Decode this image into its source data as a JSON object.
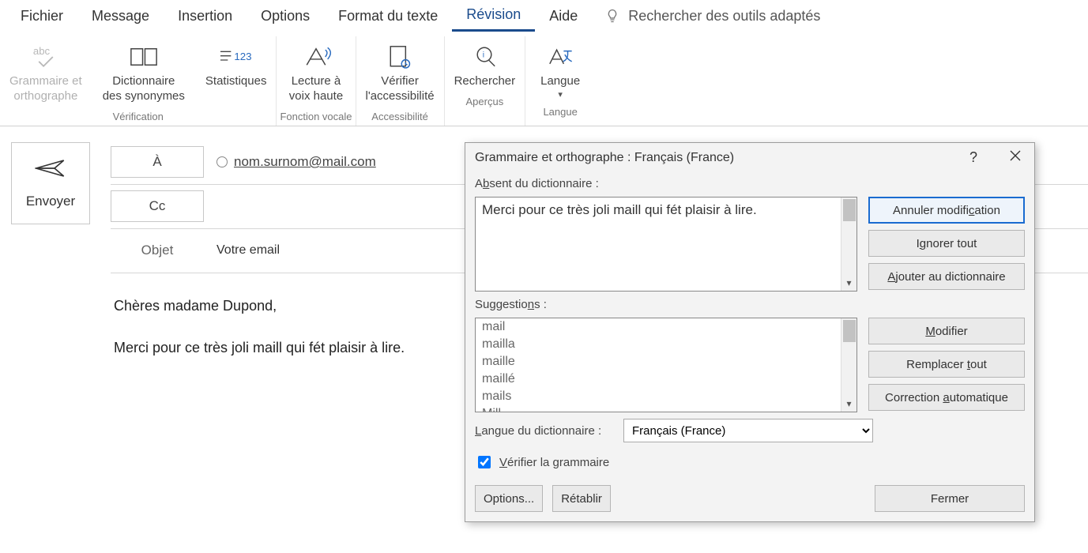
{
  "menu": {
    "items": [
      "Fichier",
      "Message",
      "Insertion",
      "Options",
      "Format du texte",
      "Révision",
      "Aide"
    ],
    "active_index": 5,
    "tellme": "Rechercher des outils adaptés"
  },
  "ribbon": {
    "groups": [
      {
        "name": "Vérification",
        "buttons": [
          {
            "label": "Grammaire et\northographe",
            "icon": "abc-check",
            "disabled": true
          },
          {
            "label": "Dictionnaire\ndes synonymes",
            "icon": "book",
            "disabled": false
          },
          {
            "label": "Statistiques",
            "icon": "count123",
            "disabled": false
          }
        ]
      },
      {
        "name": "Fonction vocale",
        "buttons": [
          {
            "label": "Lecture à\nvoix haute",
            "icon": "read-aloud",
            "disabled": false
          }
        ]
      },
      {
        "name": "Accessibilité",
        "buttons": [
          {
            "label": "Vérifier\nl'accessibilité",
            "icon": "accessibility",
            "disabled": false
          }
        ]
      },
      {
        "name": "Aperçus",
        "buttons": [
          {
            "label": "Rechercher",
            "icon": "insight",
            "disabled": false
          }
        ]
      },
      {
        "name": "Langue",
        "buttons": [
          {
            "label": "Langue",
            "icon": "language",
            "disabled": false,
            "dropdown": true
          }
        ]
      }
    ]
  },
  "compose": {
    "send": "Envoyer",
    "to_label": "À",
    "cc_label": "Cc",
    "subject_label": "Objet",
    "subject_value": "Votre email",
    "recipients": [
      {
        "address": "nom.surnom@mail.com"
      }
    ],
    "body_lines": [
      "Chères madame Dupond,",
      "Merci pour ce très joli maill qui fét plaisir à lire."
    ]
  },
  "dialog": {
    "title": "Grammaire et orthographe : Français (France)",
    "help": "?",
    "absent_label": "Absent du dictionnaire :",
    "sentence": "Merci pour ce très joli maill qui fét plaisir à lire.",
    "btns_top": [
      "Annuler modification",
      "Ignorer tout",
      "Ajouter au dictionnaire"
    ],
    "sugg_label": "Suggestions :",
    "suggestions": [
      "mail",
      "mailla",
      "maille",
      "maillé",
      "mails",
      "Mill"
    ],
    "btns_mid": [
      "Modifier",
      "Remplacer tout",
      "Correction automatique"
    ],
    "dict_label": "Langue du dictionnaire :",
    "dict_value": "Français (France)",
    "check_grammar": "Vérifier la grammaire",
    "check_grammar_checked": true,
    "options": "Options...",
    "reset": "Rétablir",
    "close": "Fermer"
  }
}
